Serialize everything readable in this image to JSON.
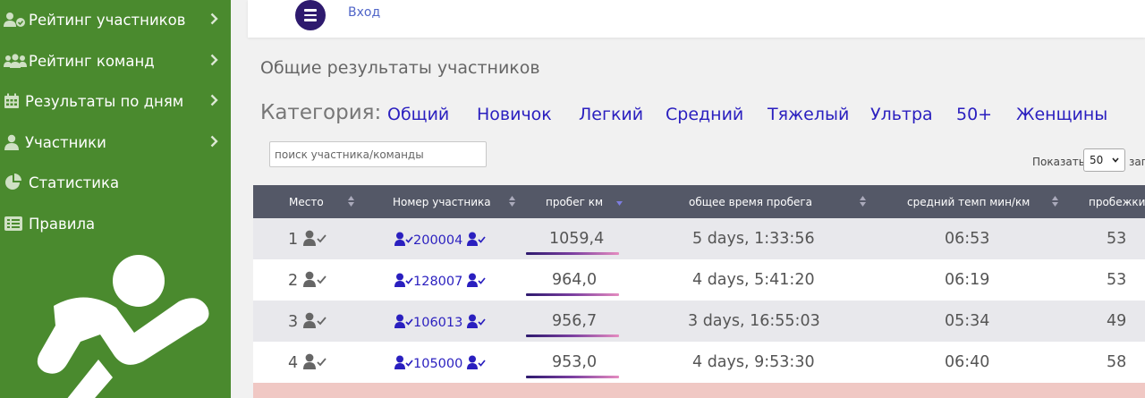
{
  "sidebar": {
    "items": [
      {
        "label": "Рейтинг участников",
        "icon": "user-check-icon"
      },
      {
        "label": "Рейтинг команд",
        "icon": "users-icon"
      },
      {
        "label": "Результаты по дням",
        "icon": "calendar-icon"
      },
      {
        "label": "Участники",
        "icon": "user-icon"
      },
      {
        "label": "Статистика",
        "icon": "pie-chart-icon"
      },
      {
        "label": "Правила",
        "icon": "list-icon"
      }
    ]
  },
  "topbar": {
    "login": "Вход"
  },
  "page": {
    "title": "Общие результаты участников"
  },
  "categories": {
    "label": "Категория:",
    "items": [
      "Общий",
      "Новичок",
      "Легкий",
      "Средний",
      "Тяжелый",
      "Ультра",
      "50+",
      "Женщины"
    ]
  },
  "search": {
    "placeholder": "поиск участника/команды"
  },
  "pagination": {
    "show_label": "Показать",
    "show_value": "50",
    "after_label": "зап"
  },
  "table": {
    "headers": [
      "Место",
      "Номер участника",
      "пробег км",
      "общее время пробега",
      "средний темп мин/км",
      "пробежки"
    ],
    "rows": [
      {
        "place": "1",
        "number": "200004",
        "km": "1059,4",
        "time": "5 days, 1:33:56",
        "pace": "06:53",
        "runs": "53"
      },
      {
        "place": "2",
        "number": "128007",
        "km": "964,0",
        "time": "4 days, 5:41:20",
        "pace": "06:19",
        "runs": "53"
      },
      {
        "place": "3",
        "number": "106013",
        "km": "956,7",
        "time": "3 days, 16:55:03",
        "pace": "05:34",
        "runs": "49"
      },
      {
        "place": "4",
        "number": "105000",
        "km": "953,0",
        "time": "4 days, 9:53:30",
        "pace": "06:40",
        "runs": "58"
      }
    ]
  },
  "colors": {
    "sidebar": "#4a8a2e",
    "header": "#545867",
    "link": "#2a1fbf",
    "row_alt": "#e8e8ec",
    "row_highlight": "#f0c8c4"
  }
}
